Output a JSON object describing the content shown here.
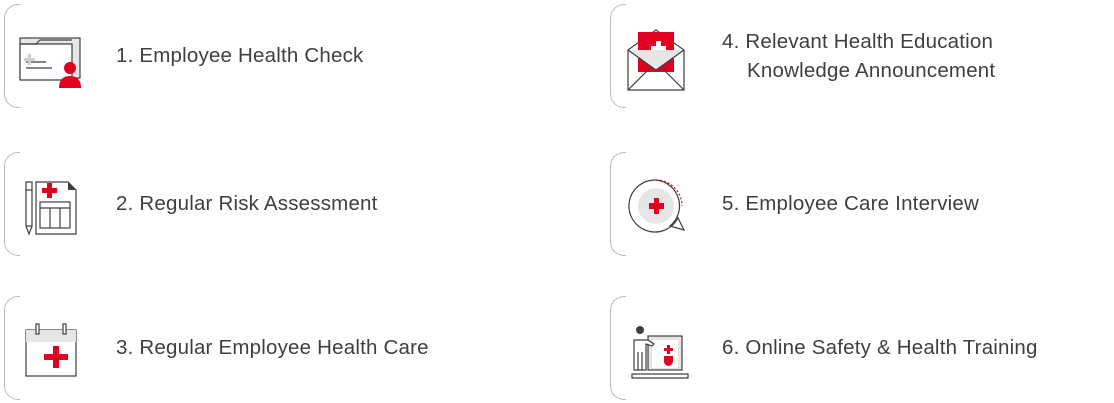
{
  "items": [
    {
      "label": "1. Employee Health Check",
      "icon": "health-check-folder-icon"
    },
    {
      "label": "2. Regular Risk Assessment",
      "icon": "risk-assessment-document-icon"
    },
    {
      "label": "3. Regular Employee Health Care",
      "icon": "health-care-calendar-icon"
    },
    {
      "label_line1": "4. Relevant Health Education",
      "label_line2": "Knowledge Announcement",
      "icon": "health-education-envelope-icon"
    },
    {
      "label": "5. Employee Care Interview",
      "icon": "care-interview-speech-bubble-icon"
    },
    {
      "label": "6. Online Safety & Health Training",
      "icon": "online-training-laptop-icon"
    }
  ],
  "colors": {
    "accent": "#e1001f",
    "gray": "#c8c8c8",
    "line": "#3f3f3f"
  }
}
